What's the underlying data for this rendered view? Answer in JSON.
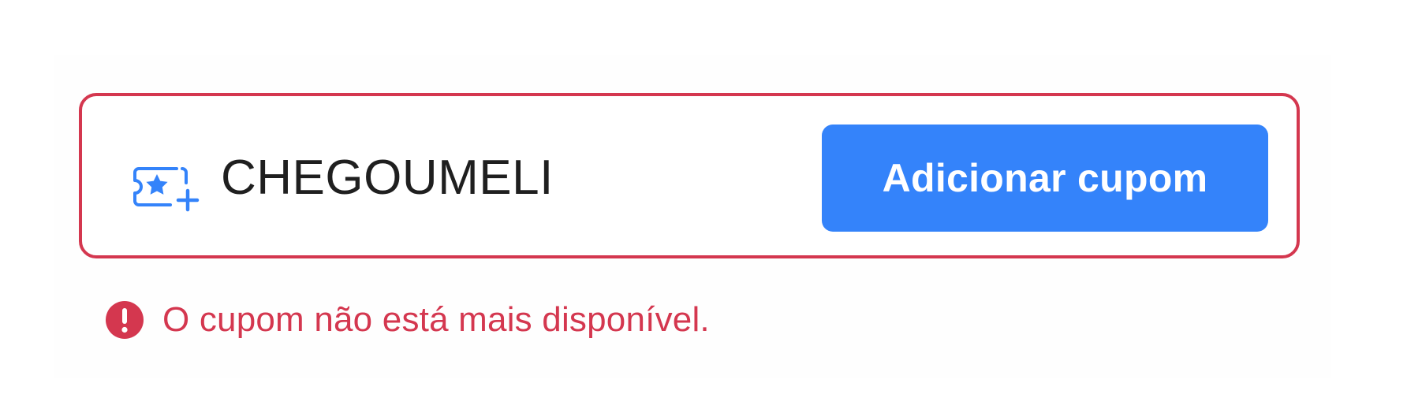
{
  "coupon": {
    "code_value": "CHEGOUMELI",
    "icon": "coupon-ticket-icon",
    "add_button_label": "Adicionar cupom"
  },
  "error": {
    "icon": "alert-circle-icon",
    "message": "O cupom não está mais disponível."
  },
  "colors": {
    "error": "#d4374f",
    "accent": "#3483fa",
    "text": "#1f1f1f",
    "icon": "#3483fa"
  }
}
